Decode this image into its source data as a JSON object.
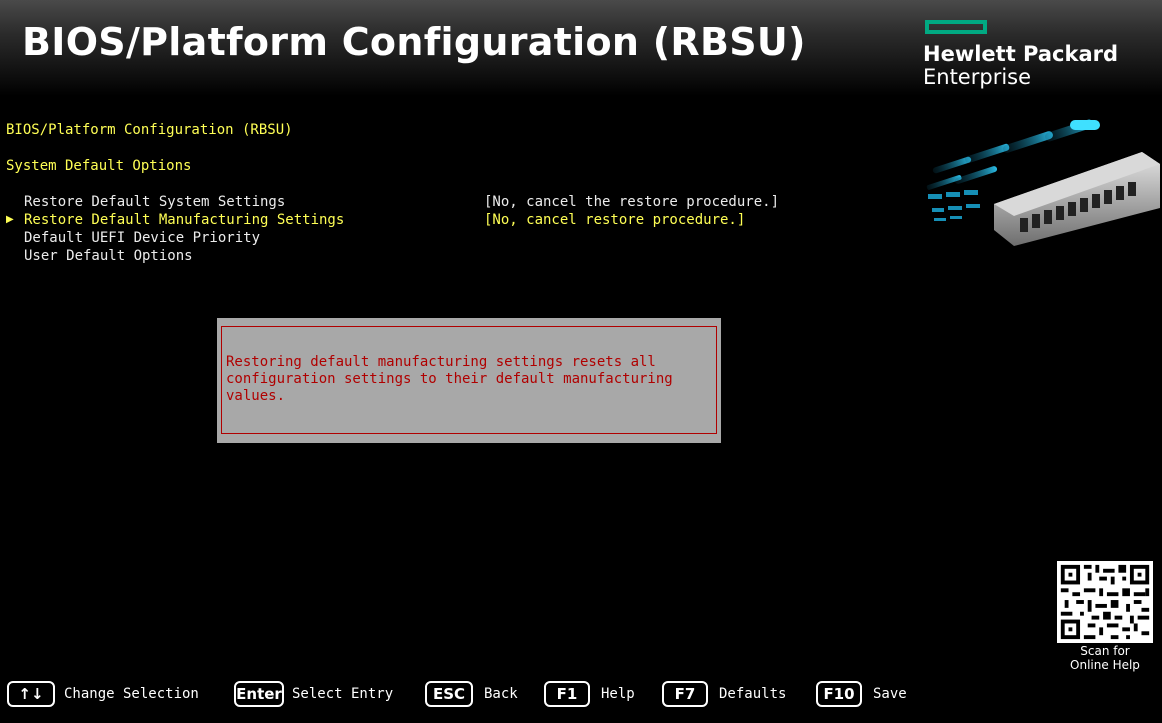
{
  "header": {
    "title": "BIOS/Platform Configuration (RBSU)",
    "brand_line1": "Hewlett Packard",
    "brand_line2": "Enterprise",
    "brand_color": "#01a982"
  },
  "breadcrumb": "BIOS/Platform Configuration (RBSU)",
  "page_title": "System Default Options",
  "menu": {
    "items": [
      {
        "label": "Restore Default System Settings",
        "value": "[No, cancel the restore procedure.]",
        "selected": false
      },
      {
        "label": "Restore Default Manufacturing Settings",
        "value": "[No, cancel restore procedure.]",
        "selected": true
      },
      {
        "label": "Default UEFI Device Priority",
        "value": "",
        "selected": false
      },
      {
        "label": "User Default Options",
        "value": "",
        "selected": false
      }
    ],
    "pointer_glyph": "▶"
  },
  "dialog": {
    "message": "Restoring default manufacturing settings resets all\nconfiguration settings to their default manufacturing\nvalues.",
    "text_color": "#b00000",
    "background": "#a8a8a8"
  },
  "help": {
    "qr_caption_line1": "Scan for",
    "qr_caption_line2": "Online Help"
  },
  "footer": {
    "keys": [
      {
        "key": "↑↓",
        "label": "Change Selection"
      },
      {
        "key": "Enter",
        "label": "Select Entry"
      },
      {
        "key": "ESC",
        "label": "Back"
      },
      {
        "key": "F1",
        "label": "Help"
      },
      {
        "key": "F7",
        "label": "Defaults"
      },
      {
        "key": "F10",
        "label": "Save"
      }
    ]
  },
  "colors": {
    "highlight": "#ffff55",
    "normal_text": "#ececec",
    "background": "#000000"
  }
}
